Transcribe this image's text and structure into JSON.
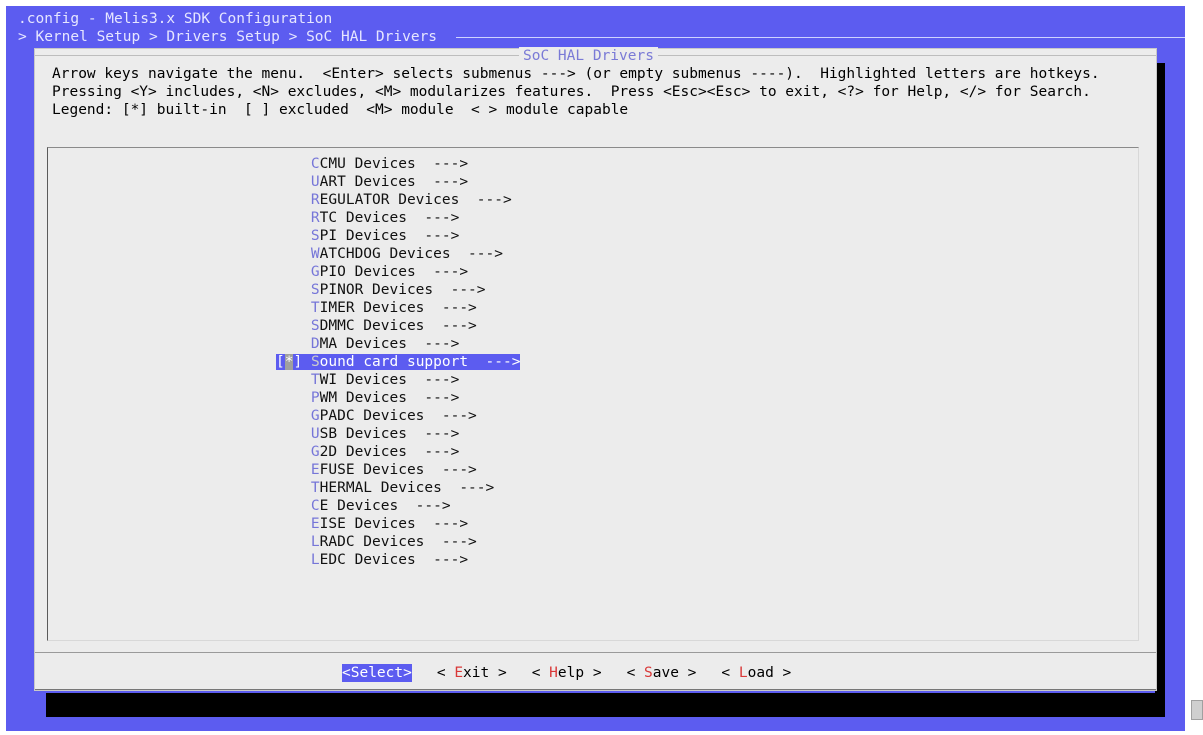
{
  "header": {
    "line1": ".config - Melis3.x SDK Configuration",
    "line2": "> Kernel Setup > Drivers Setup > SoC HAL Drivers"
  },
  "dialog": {
    "title": "SoC HAL Drivers",
    "help_lines": [
      "Arrow keys navigate the menu.  <Enter> selects submenus ---> (or empty submenus ----).  Highlighted letters are hotkeys.",
      "Pressing <Y> includes, <N> excludes, <M> modularizes features.  Press <Esc><Esc> to exit, <?> for Help, </> for Search.",
      "Legend: [*] built-in  [ ] excluded  <M> module  < > module capable"
    ]
  },
  "menu": {
    "items": [
      {
        "hotkey": "C",
        "rest": "CMU Devices  --->"
      },
      {
        "hotkey": "U",
        "rest": "ART Devices  --->"
      },
      {
        "hotkey": "R",
        "rest": "EGULATOR Devices  --->"
      },
      {
        "hotkey": "R",
        "rest": "TC Devices  --->"
      },
      {
        "hotkey": "S",
        "rest": "PI Devices  --->"
      },
      {
        "hotkey": "W",
        "rest": "ATCHDOG Devices  --->"
      },
      {
        "hotkey": "G",
        "rest": "PIO Devices  --->"
      },
      {
        "hotkey": "S",
        "rest": "PINOR Devices  --->"
      },
      {
        "hotkey": "T",
        "rest": "IMER Devices  --->"
      },
      {
        "hotkey": "S",
        "rest": "DMMC Devices  --->"
      },
      {
        "hotkey": "D",
        "rest": "MA Devices  --->"
      },
      {
        "hotkey": "T",
        "rest": "WI Devices  --->"
      },
      {
        "hotkey": "P",
        "rest": "WM Devices  --->"
      },
      {
        "hotkey": "G",
        "rest": "PADC Devices  --->"
      },
      {
        "hotkey": "U",
        "rest": "SB Devices  --->"
      },
      {
        "hotkey": "G",
        "rest": "2D Devices  --->"
      },
      {
        "hotkey": "E",
        "rest": "FUSE Devices  --->"
      },
      {
        "hotkey": "T",
        "rest": "HERMAL Devices  --->"
      },
      {
        "hotkey": "C",
        "rest": "E Devices  --->"
      },
      {
        "hotkey": "E",
        "rest": "ISE Devices  --->"
      },
      {
        "hotkey": "L",
        "rest": "RADC Devices  --->"
      },
      {
        "hotkey": "L",
        "rest": "EDC Devices  --->"
      }
    ],
    "selected": {
      "bracket_open": "[",
      "mark": "*",
      "bracket_close": "] ",
      "hotkey": "S",
      "rest": "ound card support  --->"
    }
  },
  "buttons": {
    "select": {
      "label": "<Select>"
    },
    "exit": {
      "pre": "< ",
      "hotkey": "E",
      "post": "xit >"
    },
    "help": {
      "pre": "< ",
      "hotkey": "H",
      "post": "elp >"
    },
    "save": {
      "pre": "< ",
      "hotkey": "S",
      "post": "ave >"
    },
    "load": {
      "pre": "< ",
      "hotkey": "L",
      "post": "oad >"
    }
  },
  "colors": {
    "terminal_blue": "#5c5cf0",
    "dialog_bg": "#ececec",
    "hotkey_blue": "#7676d8",
    "button_hotkey_red": "#d93838"
  }
}
